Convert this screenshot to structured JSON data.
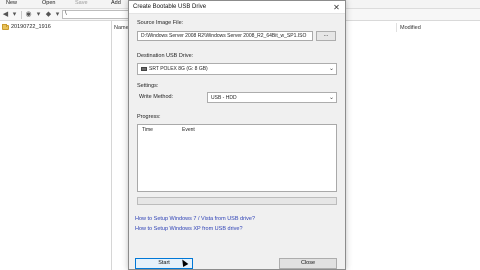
{
  "explorer": {
    "toolbar": {
      "new_label": "New",
      "open_label": "Open",
      "save_label": "Save",
      "add_label": "Add"
    },
    "address": "\\",
    "tree": {
      "folder": "20190722_1916"
    },
    "columns": {
      "name": "Name",
      "modified": "Modified"
    }
  },
  "dialog": {
    "title": "Create Bootable USB Drive",
    "source_label": "Source Image File:",
    "source_value": "D:\\Windows Server 2008 R2\\Windows Server 2008_R2_64Bit_w_SP1.ISO",
    "browse_label": "...",
    "dest_label": "Destination USB Drive:",
    "dest_value": "SRT POLEX 8G (G: 8 GB)",
    "settings_label": "Settings:",
    "write_method_label": "Write Method:",
    "write_method_value": "USB - HDD",
    "progress_label": "Progress:",
    "progress_columns": {
      "time": "Time",
      "event": "Event"
    },
    "progress_value": 0,
    "link_win7": "How to Setup Windows 7 / Vista from USB drive?",
    "link_winxp": "How to Setup Windows XP from USB drive?",
    "start_label": "Start",
    "close_label": "Close"
  },
  "colors": {
    "link": "#2b3fb5",
    "progress_fill": "#06b025",
    "default_button_border": "#0078d7"
  }
}
